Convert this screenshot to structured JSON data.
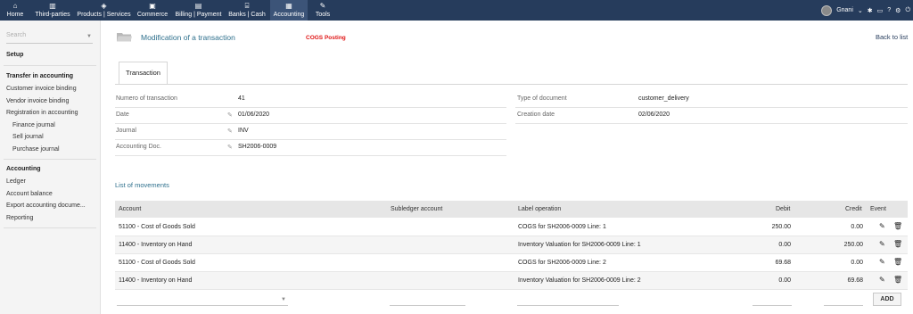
{
  "topnav": {
    "items": [
      {
        "label": "Home",
        "icon": "home-icon"
      },
      {
        "label": "Third-parties",
        "icon": "building-icon"
      },
      {
        "label": "Products | Services",
        "icon": "cube-icon"
      },
      {
        "label": "Commerce",
        "icon": "briefcase-icon"
      },
      {
        "label": "Billing | Payment",
        "icon": "invoice-icon"
      },
      {
        "label": "Banks | Cash",
        "icon": "bank-icon"
      },
      {
        "label": "Accounting",
        "icon": "calculator-icon"
      },
      {
        "label": "Tools",
        "icon": "wrench-icon"
      }
    ],
    "user": "Gnani"
  },
  "sidebar": {
    "search_placeholder": "Search",
    "setup": "Setup",
    "transfer_heading": "Transfer in accounting",
    "transfer_items": [
      "Customer invoice binding",
      "Vendor invoice binding",
      "Registration in accounting"
    ],
    "journal_items": [
      "Finance journal",
      "Sell journal",
      "Purchase journal"
    ],
    "accounting_heading": "Accounting",
    "accounting_items": [
      "Ledger",
      "Account balance",
      "Export accounting docume...",
      "Reporting"
    ]
  },
  "header": {
    "title": "Modification of a transaction",
    "badge": "COGS Posting",
    "back_link": "Back to list"
  },
  "tab": {
    "label": "Transaction"
  },
  "fields_left": [
    {
      "label": "Numero of transaction",
      "value": "41"
    },
    {
      "label": "Date",
      "value": "01/06/2020"
    },
    {
      "label": "Journal",
      "value": "INV"
    },
    {
      "label": "Accounting Doc.",
      "value": "SH2006-0009"
    }
  ],
  "fields_right": [
    {
      "label": "Type of document",
      "value": "customer_delivery"
    },
    {
      "label": "Creation date",
      "value": "02/06/2020"
    }
  ],
  "movements": {
    "title": "List of movements",
    "columns": {
      "account": "Account",
      "subledger": "Subledger account",
      "label": "Label operation",
      "debit": "Debit",
      "credit": "Credit",
      "event": "Event"
    },
    "rows": [
      {
        "account": "51100 - Cost of Goods Sold",
        "subledger": "",
        "label": "COGS for SH2006-0009 Line: 1",
        "debit": "250.00",
        "credit": "0.00"
      },
      {
        "account": "11400 - Inventory on Hand",
        "subledger": "",
        "label": "Inventory Valuation for SH2006-0009 Line: 1",
        "debit": "0.00",
        "credit": "250.00"
      },
      {
        "account": "51100 - Cost of Goods Sold",
        "subledger": "",
        "label": "COGS for SH2006-0009 Line: 2",
        "debit": "69.68",
        "credit": "0.00"
      },
      {
        "account": "11400 - Inventory on Hand",
        "subledger": "",
        "label": "Inventory Valuation for SH2006-0009 Line: 2",
        "debit": "0.00",
        "credit": "69.68"
      }
    ],
    "add_button": "ADD"
  }
}
